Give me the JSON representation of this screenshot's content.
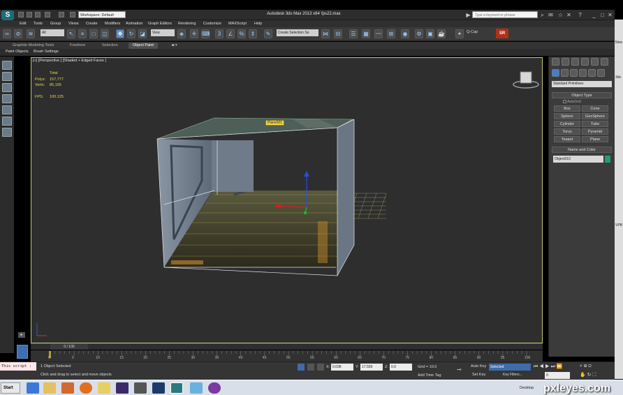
{
  "titlebar": {
    "workspace": "Workspace: Default",
    "app_title": "Autodesk 3ds Max 2013 x64",
    "file_name": "fps22.max",
    "search_placeholder": "Type a keyword or phrase"
  },
  "menu": [
    "Edit",
    "Tools",
    "Group",
    "Views",
    "Create",
    "Modifiers",
    "Animation",
    "Graph Editors",
    "Rendering",
    "Customize",
    "MAXScript",
    "Help"
  ],
  "toolbar": {
    "filter": "All",
    "ref_coord": "View",
    "named_selection": "Create Selection Se",
    "qcap": "Q-Cap",
    "sr": "SR"
  },
  "ribbon": {
    "tabs": [
      "Graphite Modeling Tools",
      "Freeform",
      "Selection",
      "Object Paint"
    ],
    "active_tab": "Object Paint",
    "sub": [
      "Paint Objects",
      "Brush Settings"
    ]
  },
  "viewport": {
    "label": "[+] [Perspective ] [Shaded + Edged Faces ]",
    "stats_header": "Total",
    "polys_label": "Polys:",
    "polys": "157,777",
    "verts_label": "Verts:",
    "verts": "85,165",
    "fps_label": "FPS:",
    "fps": "100.125",
    "object_label": "Plane001"
  },
  "command_panel": {
    "category": "Standard Primitives",
    "object_type_title": "Object Type",
    "autogrid": "AutoGrid",
    "buttons": [
      "Box",
      "Cone",
      "Sphere",
      "GeoSphere",
      "Cylinder",
      "Tube",
      "Torus",
      "Pyramid",
      "Teapot",
      "Plane"
    ],
    "name_color_title": "Name and Color",
    "object_name": "Object010",
    "object_color": "#1fa06a"
  },
  "desktop_strip": [
    "New",
    "3ds",
    "VPB"
  ],
  "timeline": {
    "frame_counter": "0 / 100",
    "ticks": [
      "0",
      "5",
      "10",
      "15",
      "20",
      "25",
      "30",
      "35",
      "40",
      "45",
      "50",
      "55",
      "60",
      "65",
      "70",
      "75",
      "80",
      "85",
      "90",
      "95",
      "100"
    ]
  },
  "status": {
    "maxscript": "This script :",
    "selected": "1 Object Selected",
    "prompt": "Click and drag to select and move objects",
    "x_label": "X:",
    "x": "0.038",
    "y_label": "Y:",
    "y": "17.559",
    "z_label": "Z:",
    "z": "0.0",
    "grid": "Grid = 10.0",
    "add_time_tag": "Add Time Tag",
    "auto_key": "Auto Key",
    "set_key": "Set Key",
    "selected_set": "Selected",
    "key_filters": "Key Filters..."
  },
  "taskbar": {
    "start": "Start",
    "desktop": "Desktop",
    "watermark": "pxleyes.com"
  }
}
